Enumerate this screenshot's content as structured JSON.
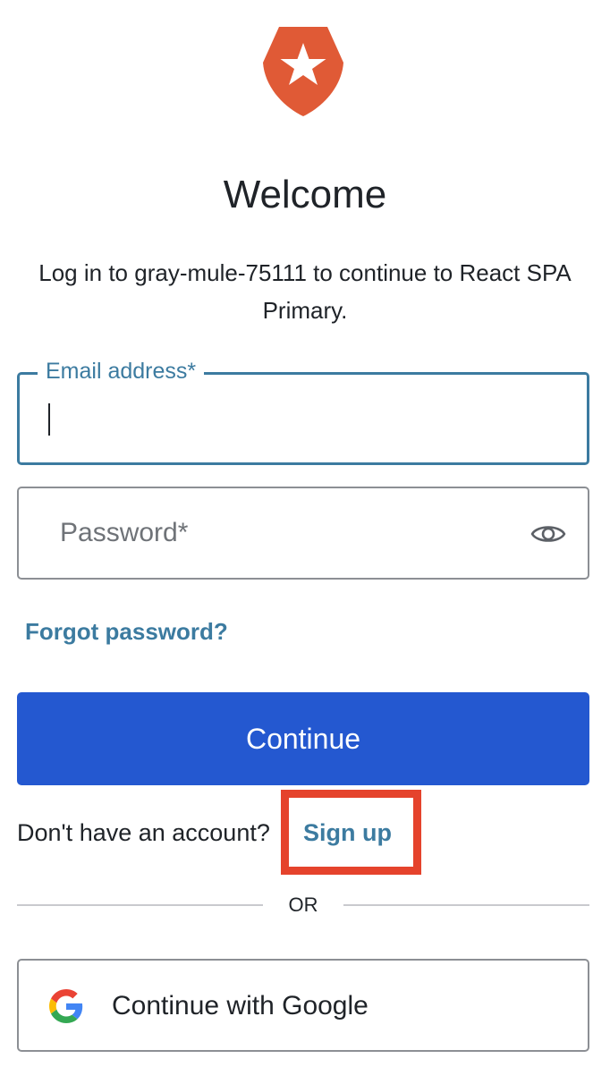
{
  "header": {
    "logo_icon": "auth0-shield-star-icon",
    "logo_color": "#e05a36",
    "title": "Welcome",
    "subtitle": "Log in to gray-mule-75111 to continue to React SPA Primary."
  },
  "form": {
    "email": {
      "label": "Email address*",
      "value": "",
      "state": "focused"
    },
    "password": {
      "placeholder": "Password*",
      "value": "",
      "toggle_icon": "eye-icon"
    },
    "forgot_password_label": "Forgot password?",
    "continue_label": "Continue"
  },
  "signup": {
    "prompt": "Don't have an account?",
    "link_label": "Sign up",
    "highlight_color": "#e5432c"
  },
  "divider": {
    "text": "OR"
  },
  "social": {
    "google_label": "Continue with Google",
    "google_icon": "google-g-icon"
  },
  "colors": {
    "primary_button": "#2458d0",
    "link": "#3c7ba0",
    "focus_border": "#3c7ba0"
  }
}
